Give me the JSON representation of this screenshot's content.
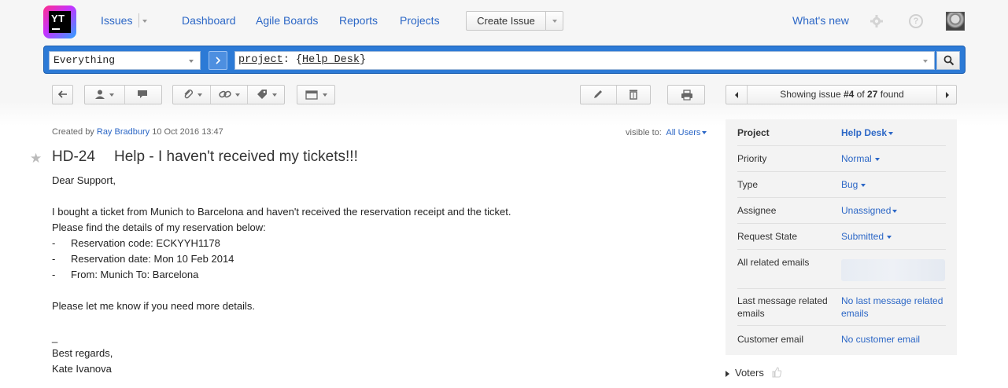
{
  "logo": {
    "text": "YT"
  },
  "nav": {
    "issues": "Issues",
    "dashboard": "Dashboard",
    "agile_boards": "Agile Boards",
    "reports": "Reports",
    "projects": "Projects",
    "create_issue": "Create Issue",
    "whats_new": "What's new"
  },
  "search": {
    "context": "Everything",
    "query_keyword": "project",
    "query_sep": ": {",
    "query_value": "Help Desk",
    "query_end": "}"
  },
  "pager": {
    "prefix": "Showing issue ",
    "current": "#4",
    "middle": " of ",
    "total": "27",
    "suffix": " found"
  },
  "issue": {
    "created_by_label": "Created by",
    "author": "Ray Bradbury",
    "created_date": "10 Oct 2016 13:47",
    "visible_to_label": "visible to:",
    "visible_to_value": "All Users",
    "id": "HD-24",
    "summary": "Help - I haven't received my tickets!!!",
    "description": {
      "greeting": "Dear Support,",
      "line1": "I bought a ticket from Munich to Barcelona and haven't received the reservation receipt and the ticket.",
      "line2": "Please find the details of my reservation below:",
      "bullet_char": "-",
      "bullets": [
        "Reservation code: ECKYYH1178",
        "Reservation date: Mon 10 Feb 2014",
        "From: Munich To: Barcelona"
      ],
      "line3": "Please let me know if you need more details.",
      "underscore": "_",
      "closing": "Best regards,",
      "signature": "Kate Ivanova"
    }
  },
  "fields": {
    "project": {
      "label": "Project",
      "value": "Help Desk"
    },
    "priority": {
      "label": "Priority",
      "value": "Normal"
    },
    "type": {
      "label": "Type",
      "value": "Bug"
    },
    "assignee": {
      "label": "Assignee",
      "value": "Unassigned"
    },
    "request_state": {
      "label": "Request State",
      "value": "Submitted"
    },
    "all_related_emails": {
      "label": "All related emails"
    },
    "last_message": {
      "label": "Last message related emails",
      "value": "No last message related emails"
    },
    "customer_email": {
      "label": "Customer email",
      "value": "No customer email"
    }
  },
  "voters": {
    "label": "Voters"
  },
  "colors": {
    "link": "#2c67c6",
    "search_bar": "#2c7ad6",
    "panel_bg": "#f3f3f3"
  }
}
